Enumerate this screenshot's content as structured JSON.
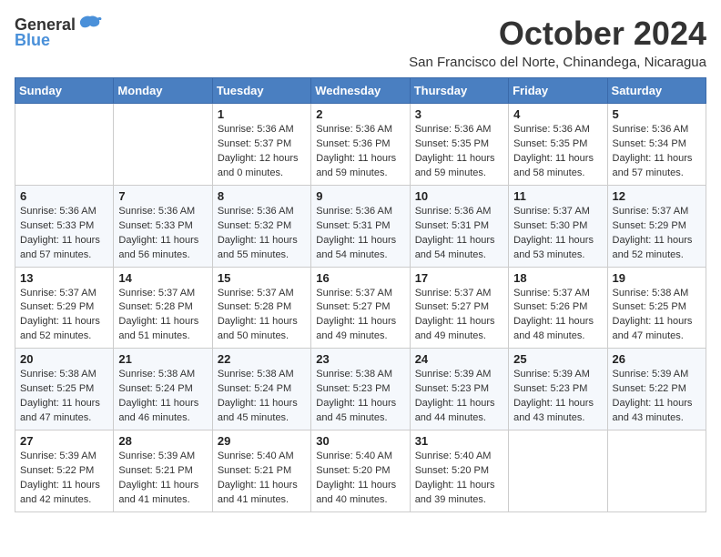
{
  "header": {
    "logo_general": "General",
    "logo_blue": "Blue",
    "month_title": "October 2024",
    "location": "San Francisco del Norte, Chinandega, Nicaragua"
  },
  "days_of_week": [
    "Sunday",
    "Monday",
    "Tuesday",
    "Wednesday",
    "Thursday",
    "Friday",
    "Saturday"
  ],
  "weeks": [
    [
      {
        "day": "",
        "info": ""
      },
      {
        "day": "",
        "info": ""
      },
      {
        "day": "1",
        "info": "Sunrise: 5:36 AM\nSunset: 5:37 PM\nDaylight: 12 hours\nand 0 minutes."
      },
      {
        "day": "2",
        "info": "Sunrise: 5:36 AM\nSunset: 5:36 PM\nDaylight: 11 hours\nand 59 minutes."
      },
      {
        "day": "3",
        "info": "Sunrise: 5:36 AM\nSunset: 5:35 PM\nDaylight: 11 hours\nand 59 minutes."
      },
      {
        "day": "4",
        "info": "Sunrise: 5:36 AM\nSunset: 5:35 PM\nDaylight: 11 hours\nand 58 minutes."
      },
      {
        "day": "5",
        "info": "Sunrise: 5:36 AM\nSunset: 5:34 PM\nDaylight: 11 hours\nand 57 minutes."
      }
    ],
    [
      {
        "day": "6",
        "info": "Sunrise: 5:36 AM\nSunset: 5:33 PM\nDaylight: 11 hours\nand 57 minutes."
      },
      {
        "day": "7",
        "info": "Sunrise: 5:36 AM\nSunset: 5:33 PM\nDaylight: 11 hours\nand 56 minutes."
      },
      {
        "day": "8",
        "info": "Sunrise: 5:36 AM\nSunset: 5:32 PM\nDaylight: 11 hours\nand 55 minutes."
      },
      {
        "day": "9",
        "info": "Sunrise: 5:36 AM\nSunset: 5:31 PM\nDaylight: 11 hours\nand 54 minutes."
      },
      {
        "day": "10",
        "info": "Sunrise: 5:36 AM\nSunset: 5:31 PM\nDaylight: 11 hours\nand 54 minutes."
      },
      {
        "day": "11",
        "info": "Sunrise: 5:37 AM\nSunset: 5:30 PM\nDaylight: 11 hours\nand 53 minutes."
      },
      {
        "day": "12",
        "info": "Sunrise: 5:37 AM\nSunset: 5:29 PM\nDaylight: 11 hours\nand 52 minutes."
      }
    ],
    [
      {
        "day": "13",
        "info": "Sunrise: 5:37 AM\nSunset: 5:29 PM\nDaylight: 11 hours\nand 52 minutes."
      },
      {
        "day": "14",
        "info": "Sunrise: 5:37 AM\nSunset: 5:28 PM\nDaylight: 11 hours\nand 51 minutes."
      },
      {
        "day": "15",
        "info": "Sunrise: 5:37 AM\nSunset: 5:28 PM\nDaylight: 11 hours\nand 50 minutes."
      },
      {
        "day": "16",
        "info": "Sunrise: 5:37 AM\nSunset: 5:27 PM\nDaylight: 11 hours\nand 49 minutes."
      },
      {
        "day": "17",
        "info": "Sunrise: 5:37 AM\nSunset: 5:27 PM\nDaylight: 11 hours\nand 49 minutes."
      },
      {
        "day": "18",
        "info": "Sunrise: 5:37 AM\nSunset: 5:26 PM\nDaylight: 11 hours\nand 48 minutes."
      },
      {
        "day": "19",
        "info": "Sunrise: 5:38 AM\nSunset: 5:25 PM\nDaylight: 11 hours\nand 47 minutes."
      }
    ],
    [
      {
        "day": "20",
        "info": "Sunrise: 5:38 AM\nSunset: 5:25 PM\nDaylight: 11 hours\nand 47 minutes."
      },
      {
        "day": "21",
        "info": "Sunrise: 5:38 AM\nSunset: 5:24 PM\nDaylight: 11 hours\nand 46 minutes."
      },
      {
        "day": "22",
        "info": "Sunrise: 5:38 AM\nSunset: 5:24 PM\nDaylight: 11 hours\nand 45 minutes."
      },
      {
        "day": "23",
        "info": "Sunrise: 5:38 AM\nSunset: 5:23 PM\nDaylight: 11 hours\nand 45 minutes."
      },
      {
        "day": "24",
        "info": "Sunrise: 5:39 AM\nSunset: 5:23 PM\nDaylight: 11 hours\nand 44 minutes."
      },
      {
        "day": "25",
        "info": "Sunrise: 5:39 AM\nSunset: 5:23 PM\nDaylight: 11 hours\nand 43 minutes."
      },
      {
        "day": "26",
        "info": "Sunrise: 5:39 AM\nSunset: 5:22 PM\nDaylight: 11 hours\nand 43 minutes."
      }
    ],
    [
      {
        "day": "27",
        "info": "Sunrise: 5:39 AM\nSunset: 5:22 PM\nDaylight: 11 hours\nand 42 minutes."
      },
      {
        "day": "28",
        "info": "Sunrise: 5:39 AM\nSunset: 5:21 PM\nDaylight: 11 hours\nand 41 minutes."
      },
      {
        "day": "29",
        "info": "Sunrise: 5:40 AM\nSunset: 5:21 PM\nDaylight: 11 hours\nand 41 minutes."
      },
      {
        "day": "30",
        "info": "Sunrise: 5:40 AM\nSunset: 5:20 PM\nDaylight: 11 hours\nand 40 minutes."
      },
      {
        "day": "31",
        "info": "Sunrise: 5:40 AM\nSunset: 5:20 PM\nDaylight: 11 hours\nand 39 minutes."
      },
      {
        "day": "",
        "info": ""
      },
      {
        "day": "",
        "info": ""
      }
    ]
  ]
}
